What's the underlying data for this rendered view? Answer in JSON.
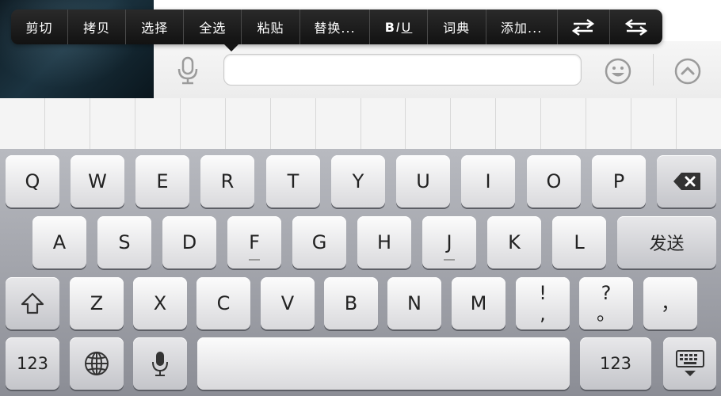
{
  "context_menu": {
    "items": [
      {
        "label": "剪切",
        "id": "cut"
      },
      {
        "label": "拷贝",
        "id": "copy"
      },
      {
        "label": "选择",
        "id": "select"
      },
      {
        "label": "全选",
        "id": "select-all"
      },
      {
        "label": "粘贴",
        "id": "paste"
      },
      {
        "label": "替换...",
        "id": "replace"
      },
      {
        "label": "词典",
        "id": "dictionary"
      },
      {
        "label": "添加...",
        "id": "add"
      }
    ],
    "format_label": {
      "b": "B",
      "i": "I",
      "u": "U"
    },
    "icons": [
      "swap-left-icon",
      "swap-right-icon"
    ]
  },
  "input_bar": {
    "text_value": "",
    "icons": {
      "mic": "microphone-icon",
      "emoji": "smiley-icon",
      "expand": "chevron-up-circle-icon"
    }
  },
  "keyboard": {
    "row1": [
      "Q",
      "W",
      "E",
      "R",
      "T",
      "Y",
      "U",
      "I",
      "O",
      "P"
    ],
    "row2": [
      "A",
      "S",
      "D",
      "F",
      "G",
      "H",
      "J",
      "K",
      "L"
    ],
    "send_label": "发送",
    "row3": [
      "Z",
      "X",
      "C",
      "V",
      "B",
      "N",
      "M"
    ],
    "punct": [
      {
        "top": "!",
        "bottom": ","
      },
      {
        "top": "?",
        "bottom": "。"
      },
      {
        "top": "，",
        "bottom": ""
      }
    ],
    "numbers_label_left": "123",
    "numbers_label_right": "123",
    "space_label": ""
  },
  "colors": {
    "menu_bg": "#1a1a1a",
    "keyboard_bg": "#9fa1a8",
    "key_face": "#f3f3f3"
  }
}
